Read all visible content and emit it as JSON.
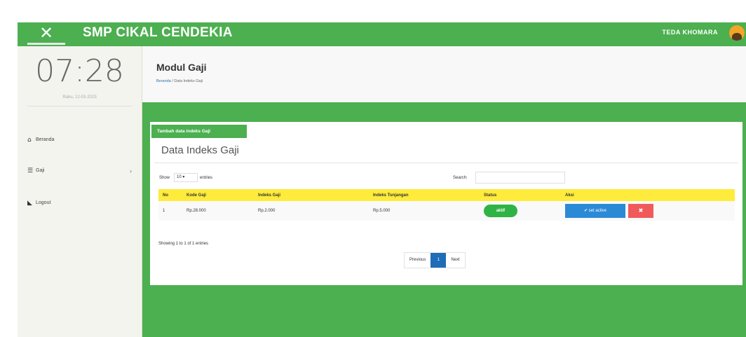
{
  "topbar": {
    "close_icon": "close-icon",
    "brand": "SMP CIKAL CENDEKIA",
    "user_name": "TEDA KHOMARA"
  },
  "sidebar": {
    "clock": "07:28",
    "date": "Rabu, 12-03-2023",
    "items": [
      {
        "label": "Beranda",
        "icon": "home-icon"
      },
      {
        "label": "Gaji",
        "icon": "list-icon",
        "has_submenu": true
      },
      {
        "label": "Logout",
        "icon": "logout-icon"
      }
    ]
  },
  "header": {
    "title": "Modul Gaji",
    "breadcrumb_link": "Beranda",
    "breadcrumb_current": " / Data Indeks Gaji"
  },
  "panel": {
    "tab_label": "Tambah data indeks Gaji",
    "title": "Data Indeks Gaji",
    "show_label": "Show",
    "show_value": "10",
    "entries_label": "entries",
    "search_label": "Search:",
    "search_value": ""
  },
  "table": {
    "columns": [
      "No",
      "Kode Gaji",
      "Indeks Gaji",
      "Indeks Tunjangan",
      "Status",
      "Aksi"
    ],
    "rows": [
      {
        "no": "1",
        "kode": "Rp.28.000",
        "indeks_gaji": "Rp.2.000",
        "indeks_tunjangan": "Rp.5.000",
        "status": "aktif",
        "edit_label": "✔ set active",
        "delete_icon": "times-icon"
      }
    ]
  },
  "footer": {
    "info": "Showing 1 to 1 of 1 entries",
    "prev": "Previous",
    "page": "1",
    "next": "Next"
  },
  "colors": {
    "primary_green": "#4caf50",
    "table_header_yellow": "#ffeb3b",
    "status_green": "#2fb344",
    "edit_blue": "#2b8ad6",
    "delete_red": "#f05a5a",
    "page_active_blue": "#1f6cb8"
  }
}
